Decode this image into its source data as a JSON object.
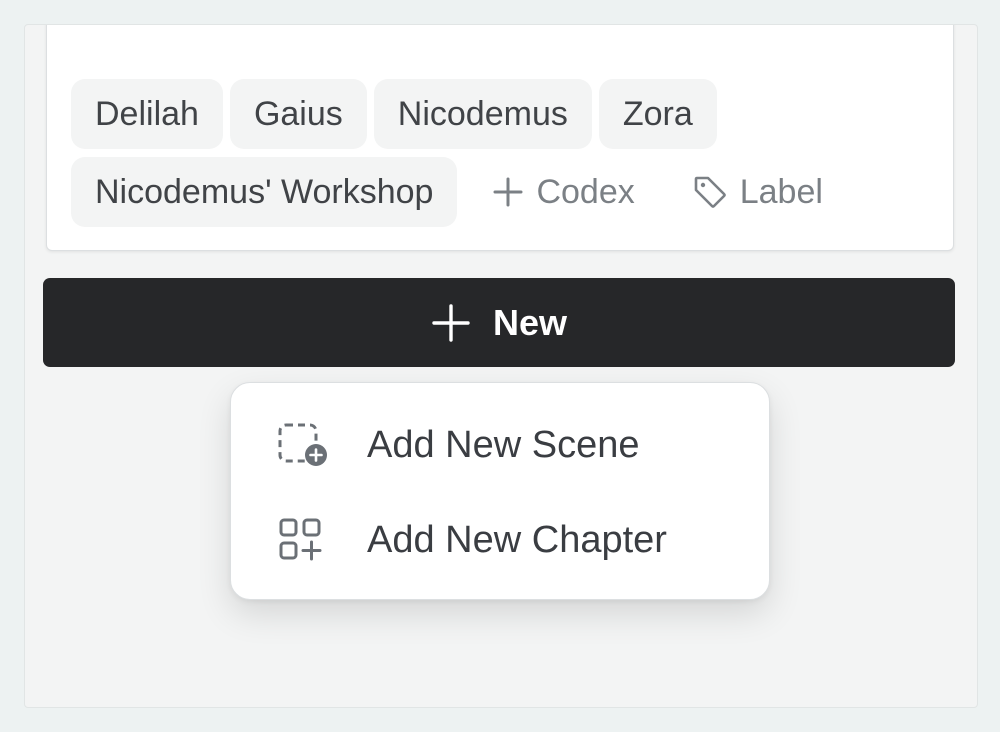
{
  "tags": [
    "Delilah",
    "Gaius",
    "Nicodemus",
    "Zora",
    "Nicodemus' Workshop"
  ],
  "actions": {
    "codex_label": "Codex",
    "label_label": "Label"
  },
  "new_button": {
    "label": "New"
  },
  "menu": {
    "items": [
      {
        "label": "Add New Scene",
        "icon": "add-scene-icon"
      },
      {
        "label": "Add New Chapter",
        "icon": "add-chapter-icon"
      }
    ]
  },
  "colors": {
    "button_bg": "#262729",
    "tag_bg": "#f3f4f4",
    "muted_text": "#7b8085"
  }
}
